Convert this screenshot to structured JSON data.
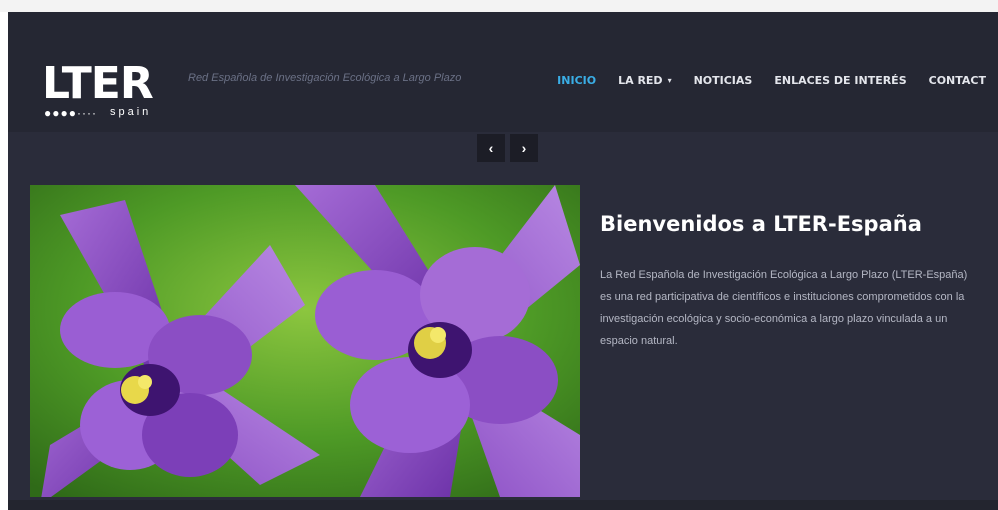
{
  "site": {
    "logo_text": "LTER",
    "logo_dots": "●●●●····",
    "logo_sub": "spain",
    "tagline": "Red Española de Investigación Ecológica a Largo Plazo"
  },
  "nav": {
    "items": [
      {
        "label": "INICIO",
        "active": true
      },
      {
        "label": "LA RED",
        "dropdown": true
      },
      {
        "label": "NOTICIAS"
      },
      {
        "label": "ENLACES DE INTERÉS"
      },
      {
        "label": "CONTACT"
      }
    ],
    "dropdown_glyph": "▾"
  },
  "slider": {
    "prev_glyph": "‹",
    "next_glyph": "›",
    "title": "Bienvenidos a LTER-España",
    "text": "La Red Española de Investigación Ecológica a Largo Plazo (LTER-España) es una red participativa de científicos e instituciones comprometidos con la investigación ecológica y socio-económica a largo plazo vinculada a un espacio natural."
  },
  "colors": {
    "accent": "#3aaee6",
    "header_bg": "#252733",
    "body_bg": "#2a2c3a"
  }
}
